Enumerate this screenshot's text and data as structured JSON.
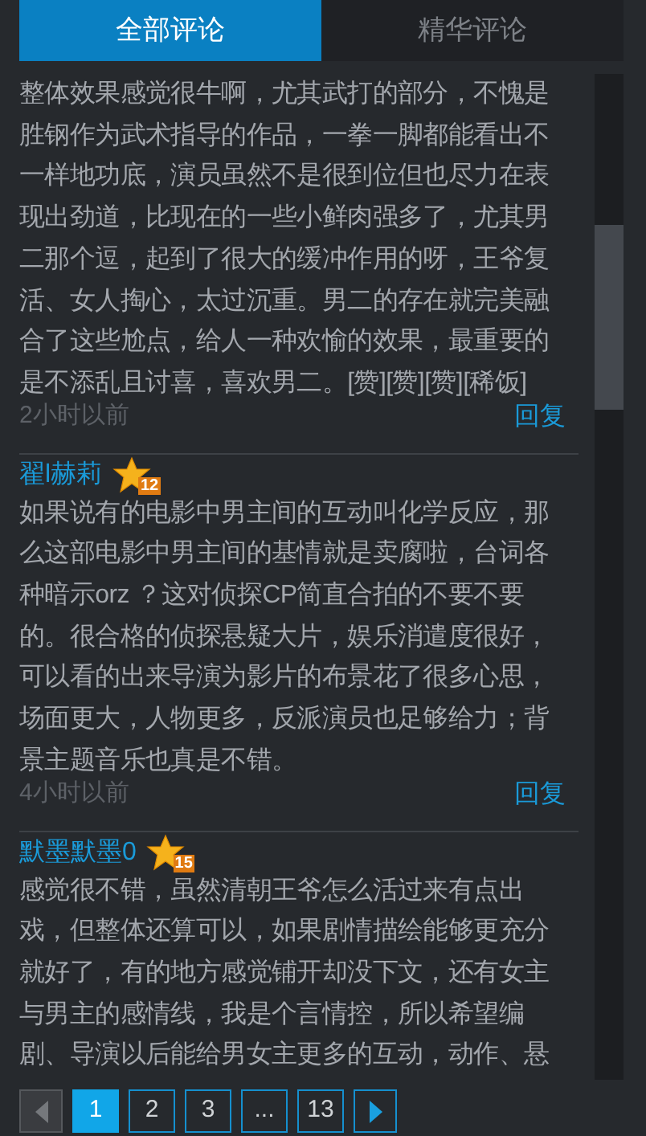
{
  "tabs": [
    {
      "label": "全部评论",
      "selected": true
    },
    {
      "label": "精华评论",
      "selected": false
    }
  ],
  "comments": [
    {
      "lines": [
        "整体效果感觉很牛啊，尤其武打的部分，不愧是",
        "胜钢作为武术指导的作品，一拳一脚都能看出不",
        "一样地功底，演员虽然不是很到位但也尽力在表",
        "现出劲道，比现在的一些小鲜肉强多了，尤其男",
        "二那个逗，起到了很大的缓冲作用的呀，王爷复",
        "活、女人掏心，太过沉重。男二的存在就完美融",
        "合了这些尬点，给人一种欢愉的效果，最重要的",
        "是不添乱且讨喜，喜欢男二。[赞][赞][赞][稀饭]"
      ],
      "time": "2小时以前",
      "reply": "回复"
    },
    {
      "user": "翟l赫莉",
      "rank": "12",
      "lines": [
        "如果说有的电影中男主间的互动叫化学反应，那",
        "么这部电影中男主间的基情就是卖腐啦，台词各",
        "种暗示orz ？这对侦探CP简直合拍的不要不要",
        "的。很合格的侦探悬疑大片，娱乐消遣度很好，",
        "可以看的出来导演为影片的布景花了很多心思，",
        "场面更大，人物更多，反派演员也足够给力；背",
        "景主题音乐也真是不错。"
      ],
      "time": "4小时以前",
      "reply": "回复"
    },
    {
      "user": "默墨默墨0",
      "rank": "15",
      "lines": [
        "感觉很不错，虽然清朝王爷怎么活过来有点出",
        "戏，但整体还算可以，如果剧情描绘能够更充分",
        "就好了，有的地方感觉铺开却没下文，还有女主",
        "与男主的感情线，我是个言情控，所以希望编",
        "剧、导演以后能给男女主更多的互动，动作、悬"
      ]
    }
  ],
  "pagination": {
    "prev": {
      "disabled": true
    },
    "pages": [
      {
        "label": "1",
        "selected": true
      },
      {
        "label": "2",
        "selected": false
      },
      {
        "label": "3",
        "selected": false
      },
      {
        "label": "...",
        "selected": false
      },
      {
        "label": "13",
        "selected": false
      }
    ],
    "next": {
      "disabled": false
    }
  }
}
